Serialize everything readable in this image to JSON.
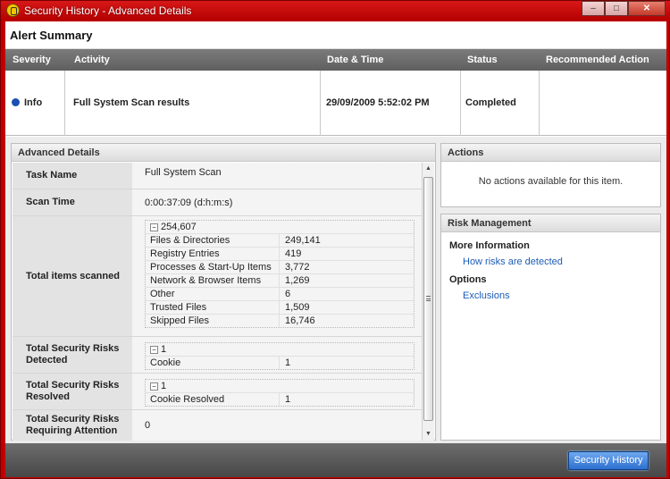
{
  "window": {
    "title": "Security History - Advanced Details",
    "controls": {
      "minimize": "–",
      "maximize": "□",
      "close": "✕"
    }
  },
  "alert_summary": {
    "title": "Alert Summary",
    "columns": [
      "Severity",
      "Activity",
      "Date & Time",
      "Status",
      "Recommended Action"
    ],
    "row": {
      "severity": "Info",
      "activity": "Full System Scan results",
      "datetime": "29/09/2009 5:52:02 PM",
      "status": "Completed",
      "recommended_action": ""
    }
  },
  "advanced_details": {
    "title": "Advanced Details",
    "task_name": {
      "label": "Task Name",
      "value": "Full System Scan"
    },
    "scan_time": {
      "label": "Scan Time",
      "value": "0:00:37:09 (d:h:m:s)"
    },
    "total_scanned": {
      "label": "Total items scanned",
      "total": "254,607",
      "items": [
        {
          "k": "Files & Directories",
          "v": "249,141"
        },
        {
          "k": "Registry Entries",
          "v": "419"
        },
        {
          "k": "Processes & Start-Up Items",
          "v": "3,772"
        },
        {
          "k": "Network & Browser Items",
          "v": "1,269"
        },
        {
          "k": "Other",
          "v": "6"
        },
        {
          "k": "Trusted Files",
          "v": "1,509"
        },
        {
          "k": "Skipped Files",
          "v": "16,746"
        }
      ]
    },
    "risks_detected": {
      "label": "Total Security Risks Detected",
      "total": "1",
      "items": [
        {
          "k": "Cookie",
          "v": "1"
        }
      ]
    },
    "risks_resolved": {
      "label": "Total Security Risks Resolved",
      "total": "1",
      "items": [
        {
          "k": "Cookie Resolved",
          "v": "1"
        }
      ]
    },
    "risks_attention": {
      "label": "Total Security Risks Requiring Attention",
      "value": "0"
    }
  },
  "actions": {
    "title": "Actions",
    "message": "No actions available for this item."
  },
  "risk_management": {
    "title": "Risk Management",
    "more_info_label": "More Information",
    "more_info_link": "How risks are detected",
    "options_label": "Options",
    "options_link": "Exclusions"
  },
  "footer": {
    "history_button": "Security History"
  },
  "icons": {
    "expander": "minus-box-icon",
    "severity": "info-dot-icon",
    "app": "norton-icon"
  },
  "colors": {
    "frame": "#c00000",
    "link": "#1d5cb5",
    "info_dot": "#1b4fb3",
    "button": "#2d6fd0"
  }
}
